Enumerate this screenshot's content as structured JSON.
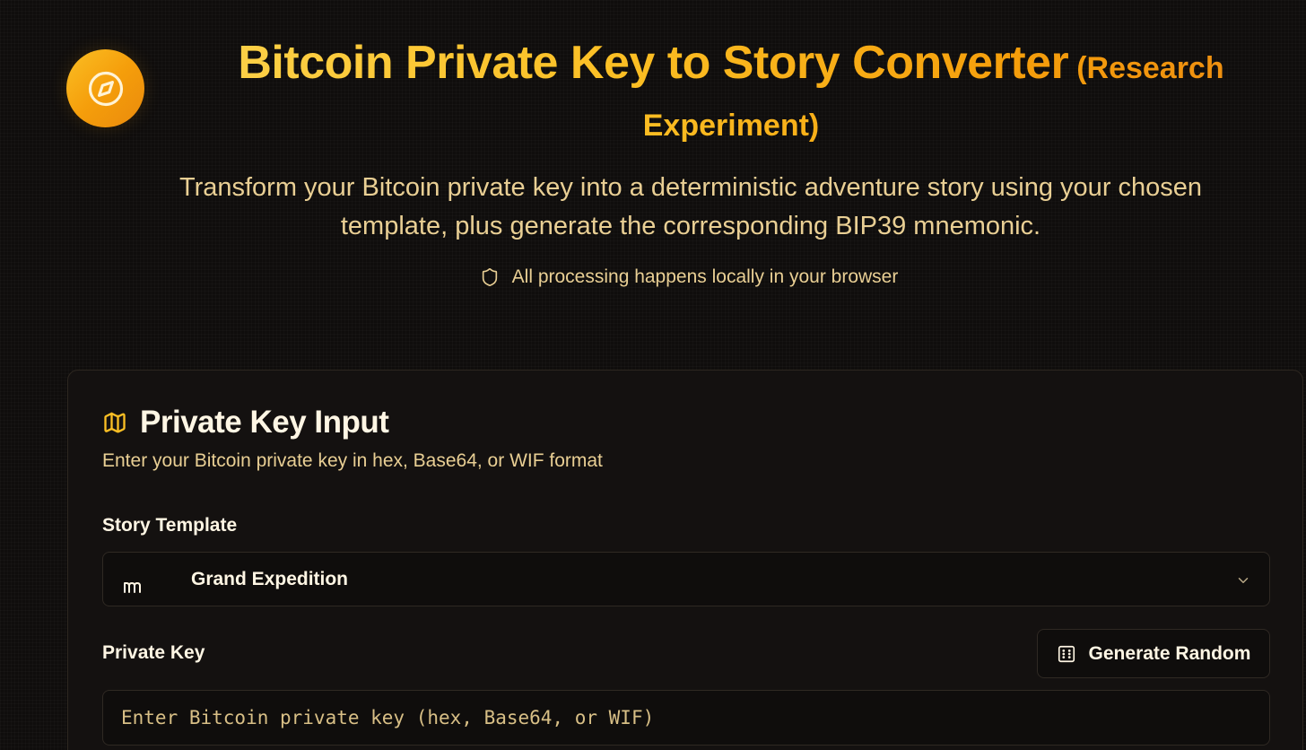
{
  "header": {
    "title": "Bitcoin Private Key to Story Converter",
    "title_suffix": "(Research Experiment)",
    "subtitle": "Transform your Bitcoin private key into a deterministic adventure story using your chosen template, plus generate the corresponding BIP39 mnemonic.",
    "privacy_note": "All processing happens locally in your browser"
  },
  "card": {
    "title": "Private Key Input",
    "description": "Enter your Bitcoin private key in hex, Base64, or WIF format",
    "template_label": "Story Template",
    "template_value": "Grand Expedition",
    "key_label": "Private Key",
    "generate_button": "Generate Random",
    "key_placeholder": "Enter Bitcoin private key (hex, Base64, or WIF)",
    "key_value": ""
  },
  "icons": {
    "logo": "compass-icon",
    "privacy": "shield-icon",
    "card": "map-icon",
    "template": "mountain-icon",
    "dropdown": "chevron-down-icon",
    "generate": "dice-icon"
  },
  "colors": {
    "accent": "#fbbf24",
    "accent_dark": "#f59e0b",
    "text_muted": "#e9cf94",
    "background": "#0f0d0c",
    "card_border": "#2d2720"
  }
}
